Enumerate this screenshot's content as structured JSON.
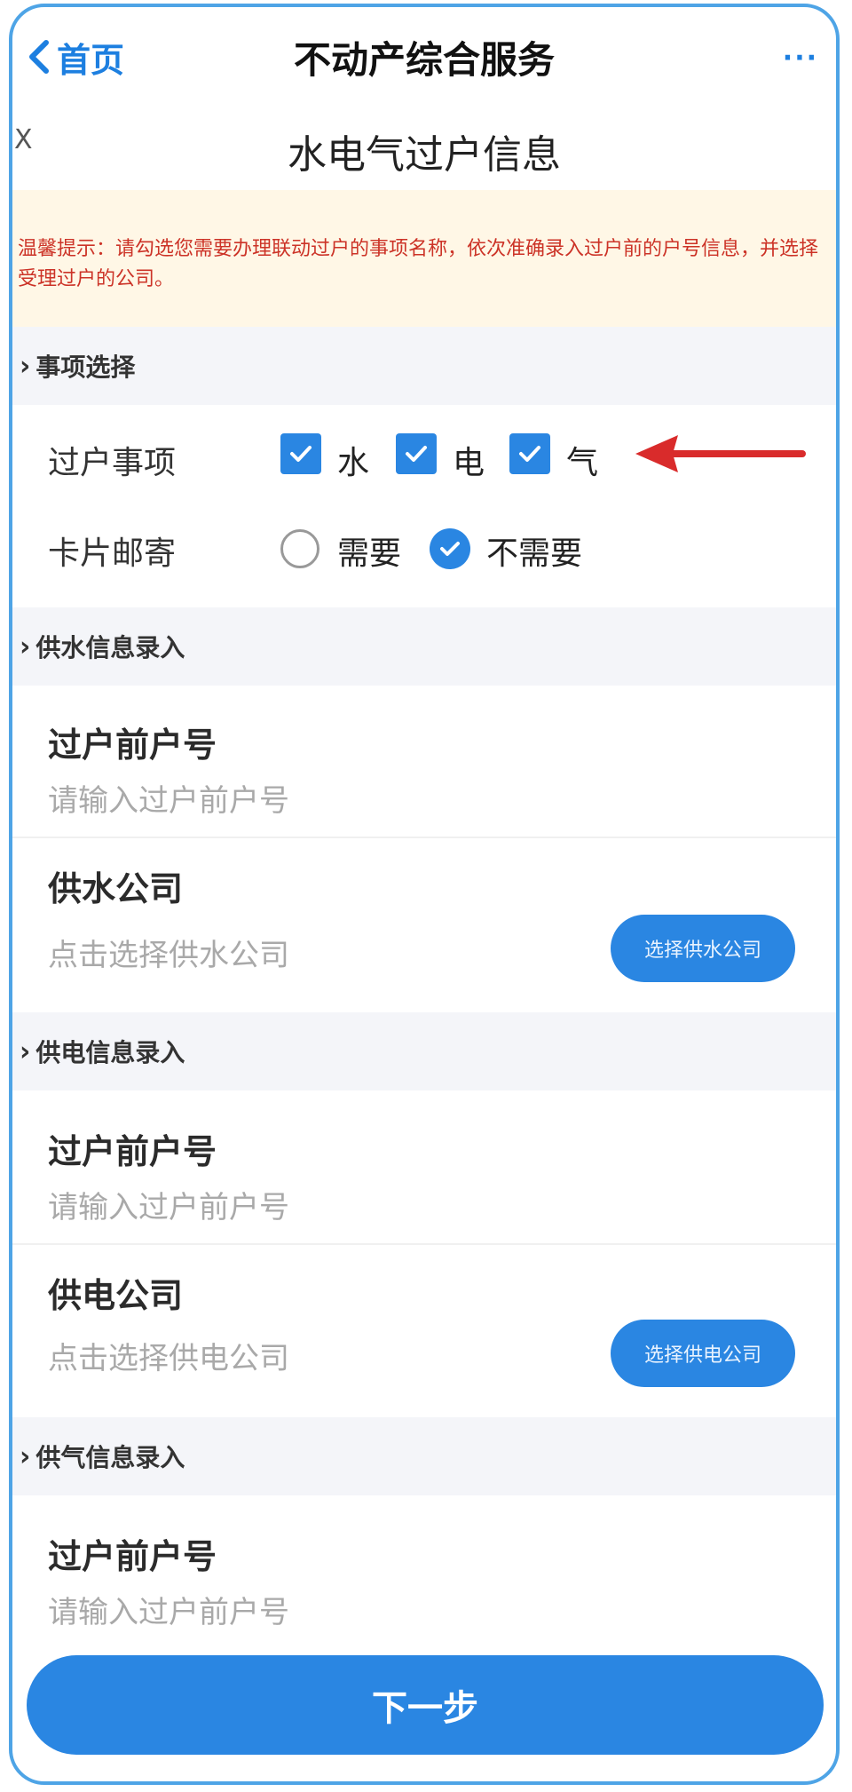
{
  "nav": {
    "back_label": "首页",
    "title": "不动产综合服务",
    "more": "···"
  },
  "page": {
    "left_glyph": "X",
    "title": "水电气过户信息"
  },
  "notice": {
    "text": "温馨提示：请勾选您需要办理联动过户的事项名称，依次准确录入过户前的户号信息，并选择受理过户的公司。"
  },
  "sections": {
    "items": "事项选择",
    "water": "供水信息录入",
    "power": "供电信息录入",
    "gas": "供气信息录入"
  },
  "transfer_items": {
    "label": "过户事项",
    "options": [
      {
        "label": "水",
        "checked": true
      },
      {
        "label": "电",
        "checked": true
      },
      {
        "label": "气",
        "checked": true
      }
    ]
  },
  "card_mail": {
    "label": "卡片邮寄",
    "options": [
      {
        "label": "需要",
        "selected": false
      },
      {
        "label": "不需要",
        "selected": true
      }
    ]
  },
  "water": {
    "account_label": "过户前户号",
    "account_placeholder": "请输入过户前户号",
    "company_label": "供水公司",
    "company_placeholder": "点击选择供水公司",
    "company_button": "选择供水公司"
  },
  "power": {
    "account_label": "过户前户号",
    "account_placeholder": "请输入过户前户号",
    "company_label": "供电公司",
    "company_placeholder": "点击选择供电公司",
    "company_button": "选择供电公司"
  },
  "gas": {
    "account_label": "过户前户号",
    "account_placeholder": "请输入过户前户号"
  },
  "footer": {
    "next_label": "下一步"
  },
  "colors": {
    "accent": "#2a86e2",
    "notice_text": "#cc3327",
    "notice_bg": "#fff7e6",
    "arrow": "#d92b2b"
  }
}
